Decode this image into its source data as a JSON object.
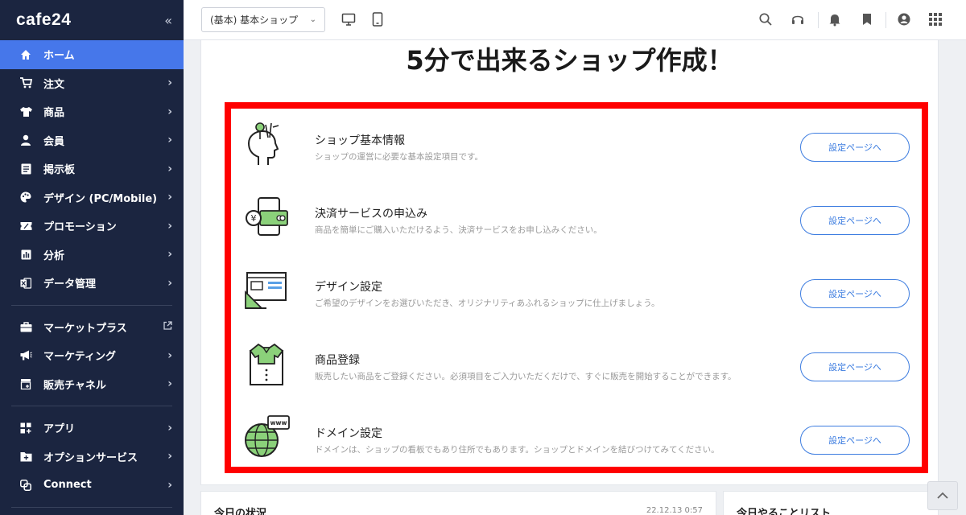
{
  "sidebar": {
    "logo": "cafe24",
    "collapse_icon": "«",
    "items": [
      {
        "label": "ホーム",
        "icon": "home-icon",
        "active": true
      },
      {
        "label": "注文",
        "icon": "cart-icon"
      },
      {
        "label": "商品",
        "icon": "shirt-icon"
      },
      {
        "label": "会員",
        "icon": "person-icon"
      },
      {
        "label": "掲示板",
        "icon": "board-icon"
      },
      {
        "label": "デザイン (PC/Mobile)",
        "icon": "palette-icon"
      },
      {
        "label": "プロモーション",
        "icon": "ticket-icon"
      },
      {
        "label": "分析",
        "icon": "analytics-icon"
      },
      {
        "label": "データ管理",
        "icon": "excel-icon"
      },
      {
        "label": "マーケットプラス",
        "icon": "briefcase-icon"
      },
      {
        "label": "マーケティング",
        "icon": "megaphone-icon"
      },
      {
        "label": "販売チャネル",
        "icon": "store-icon"
      },
      {
        "label": "アプリ",
        "icon": "apps-icon"
      },
      {
        "label": "オプションサービス",
        "icon": "folder-plus-icon"
      },
      {
        "label": "Connect",
        "icon": "link-icon"
      }
    ]
  },
  "header": {
    "shop_select_value": "(基本) 基本ショップ",
    "icons": [
      "monitor-icon",
      "tablet-icon",
      "search-icon",
      "headset-icon",
      "bell-icon",
      "bookmark-icon",
      "user-icon",
      "grid-icon"
    ]
  },
  "main": {
    "hero_title": "5分で出来るショップ作成！",
    "rows": [
      {
        "title": "ショップ基本情報",
        "desc": "ショップの運営に必要な基本設定項目です。",
        "button": "設定ページへ",
        "icon": "head-tools-icon"
      },
      {
        "title": "決済サービスの申込み",
        "desc": "商品を簡単にご購入いただけるよう、決済サービスをお申し込みください。",
        "button": "設定ページへ",
        "icon": "payment-phone-icon"
      },
      {
        "title": "デザイン設定",
        "desc": "ご希望のデザインをお選びいただき、オリジナリティあふれるショップに仕上げましょう。",
        "button": "設定ページへ",
        "icon": "design-window-icon"
      },
      {
        "title": "商品登録",
        "desc": "販売したい商品をご登録ください。必須項目をご入力いただくだけで、すぐに販売を開始することができます。",
        "button": "設定ページへ",
        "icon": "product-shirt-icon"
      },
      {
        "title": "ドメイン設定",
        "desc": "ドメインは、ショップの看板でもあり住所でもあります。ショップとドメインを結びつけてみてください。",
        "button": "設定ページへ",
        "icon": "globe-www-icon"
      }
    ]
  },
  "cards": {
    "today_status": {
      "title": "今日の状況",
      "date": "22.12.13 0:57"
    },
    "todo": {
      "title": "今日やることリスト"
    }
  },
  "colors": {
    "sidebar_bg": "#1b2540",
    "active": "#4677ea",
    "highlight": "#ff0000",
    "button": "#3d7de0"
  }
}
